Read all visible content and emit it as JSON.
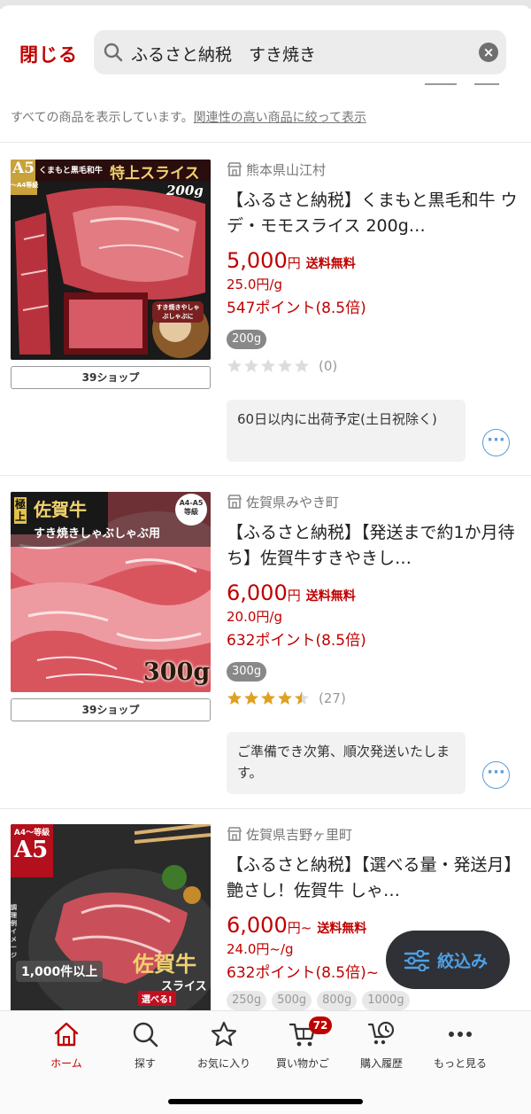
{
  "header": {
    "close_label": "閉じる",
    "search_query": "ふるさと納税　すき焼き"
  },
  "notice": {
    "text": "すべての商品を表示しています。",
    "link_text": "関連性の高い商品に絞って表示"
  },
  "products": [
    {
      "shop_button": "39ショップ",
      "seller": "熊本県山江村",
      "title": "【ふるさと納税】くまもと黒毛和牛 ウデ・モモスライス 200g…",
      "price": "5,000",
      "price_unit": "円",
      "price_suffix": "",
      "shipping": "送料無料",
      "unit_price": "25.0円/g",
      "points": "547ポイント(8.5倍)",
      "tag": "200g",
      "rating": 0,
      "review_count": "(0)",
      "ship_note": "60日以内に出荷予定(土日祝除く)",
      "image_text": {
        "grade": "A5",
        "grade_sub": "〜A4等級",
        "brand": "くまもと黒毛和牛",
        "headline": "特上スライス",
        "weight": "200g",
        "caption": "すき焼きやしゃぶしゃぶに"
      }
    },
    {
      "shop_button": "39ショップ",
      "seller": "佐賀県みやき町",
      "title": "【ふるさと納税】【発送まで約1か月待ち】佐賀牛すきやきし…",
      "price": "6,000",
      "price_unit": "円",
      "price_suffix": "",
      "shipping": "送料無料",
      "unit_price": "20.0円/g",
      "points": "632ポイント(8.5倍)",
      "tag": "300g",
      "rating": 4.5,
      "review_count": "(27)",
      "ship_note": "ご準備でき次第、順次発送いたします。",
      "image_text": {
        "badge": "極上",
        "brand": "佐賀牛",
        "grade": "A4-A5等級",
        "headline": "すき焼きしゃぶしゃぶ用",
        "weight": "300g"
      }
    },
    {
      "shop_button": "",
      "seller": "佐賀県吉野ヶ里町",
      "title": "【ふるさと納税】【選べる量・発送月】艶さし！佐賀牛 しゃ…",
      "price": "6,000",
      "price_unit": "円",
      "price_suffix": "~",
      "shipping": "送料無料",
      "unit_price": "24.0円~/g",
      "points": "632ポイント(8.5倍)~",
      "image_text": {
        "grade": "A4〜等級",
        "grade_big": "A5",
        "brand": "佐賀牛",
        "headline": "スライス",
        "count_badge": "1,000件以上",
        "choose": "選べる!",
        "side_note": "調理例イメージ"
      },
      "chips": [
        "250g",
        "500g",
        "800g",
        "1000g"
      ]
    }
  ],
  "filter_button": {
    "label": "絞込み"
  },
  "tabbar": {
    "items": [
      {
        "label": "ホーム",
        "icon": "home-icon"
      },
      {
        "label": "探す",
        "icon": "search-icon"
      },
      {
        "label": "お気に入り",
        "icon": "star-icon"
      },
      {
        "label": "買い物かご",
        "icon": "cart-icon",
        "badge": "72"
      },
      {
        "label": "購入履歴",
        "icon": "history-icon"
      },
      {
        "label": "もっと見る",
        "icon": "more-icon"
      }
    ]
  },
  "colors": {
    "accent": "#bf0000",
    "link_blue": "#5b9bd5",
    "fab_bg": "#2f3136",
    "star_gold": "#e0a020"
  }
}
